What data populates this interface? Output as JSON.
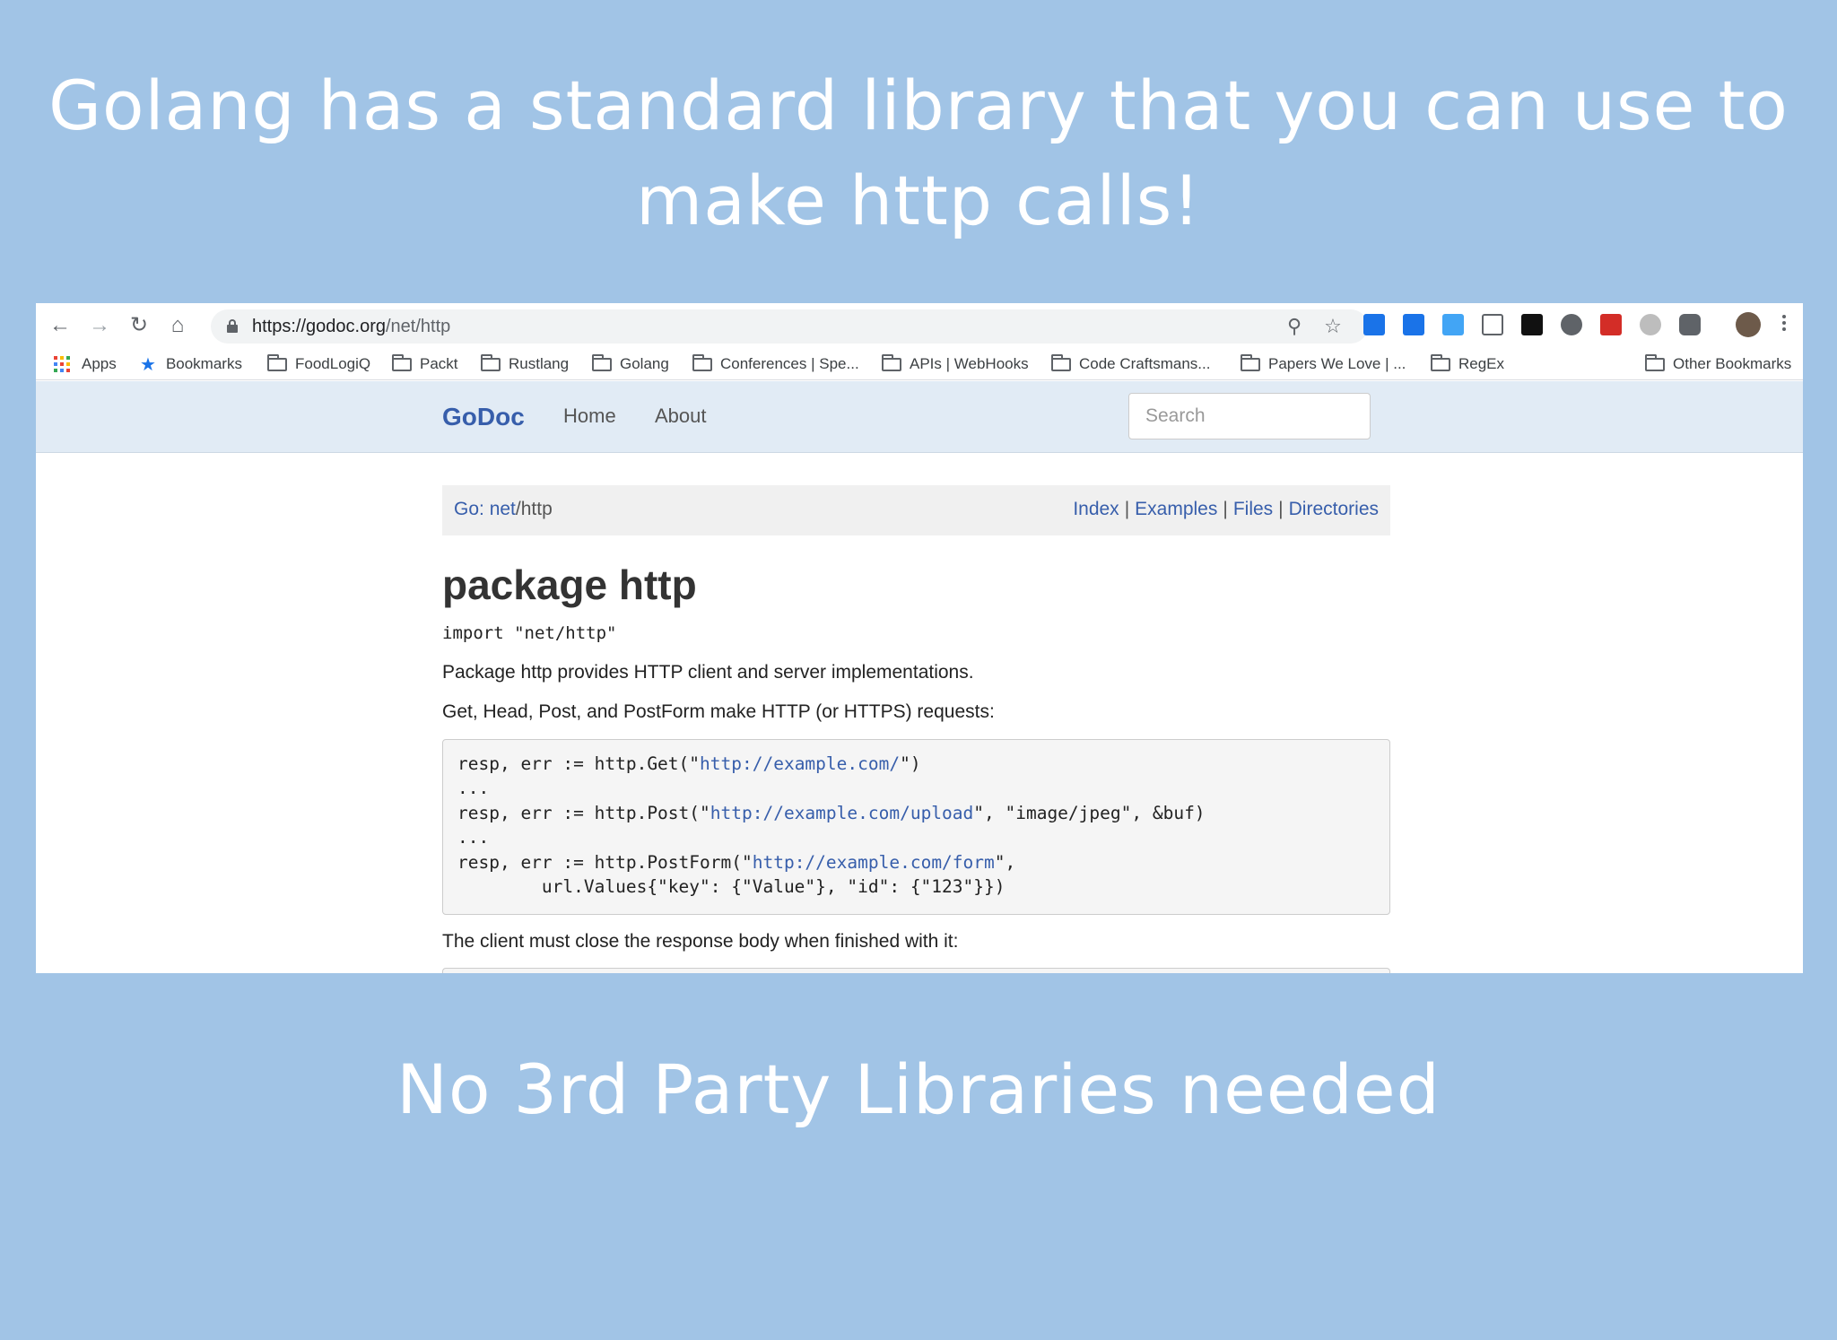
{
  "slide": {
    "headline_line1": "Golang has a standard library that you can use to",
    "headline_line2": "make http calls!",
    "subline": "No 3rd Party Libraries needed",
    "background_color": "#a1c4e6"
  },
  "browser": {
    "address": {
      "host": "https://godoc.org",
      "path": "/net/http"
    },
    "toolbar_icons": [
      "back-arrow-icon",
      "forward-arrow-icon",
      "reload-icon",
      "home-icon",
      "lock-icon",
      "zoom-icon",
      "bookmark-star-icon",
      "kebab-menu-icon"
    ],
    "extensions": [
      {
        "name": "extension-expand-icon",
        "color": "#1a73e8"
      },
      {
        "name": "extension-edit-icon",
        "color": "#1a73e8"
      },
      {
        "name": "extension-window-icon",
        "color": "#42a5f5"
      },
      {
        "name": "extension-screenshot-icon",
        "color": "#5f6368"
      },
      {
        "name": "extension-perplexity-icon",
        "color": "#111111"
      },
      {
        "name": "extension-gear-icon",
        "color": "#5f6368"
      },
      {
        "name": "extension-lastpass-icon",
        "color": "#d32d27"
      },
      {
        "name": "extension-cloud-icon",
        "color": "#bdbdbd"
      },
      {
        "name": "extension-pocket-icon",
        "color": "#5f6368"
      },
      {
        "name": "profile-avatar",
        "color": "#6d5a4a"
      }
    ],
    "bookmarks": {
      "apps": "Apps",
      "bookmarks": "Bookmarks",
      "folders": [
        "FoodLogiQ",
        "Packt",
        "Rustlang",
        "Golang",
        "Conferences | Spe...",
        "APIs | WebHooks",
        "Code Craftsmans...",
        "Papers We Love | ...",
        "RegEx"
      ],
      "other": "Other Bookmarks"
    }
  },
  "godoc": {
    "brand": "GoDoc",
    "nav_home": "Home",
    "nav_about": "About",
    "search_placeholder": "Search",
    "breadcrumb_prefix": "Go: ",
    "breadcrumb_net": "net",
    "breadcrumb_http": "/http",
    "links": {
      "index": "Index",
      "examples": "Examples",
      "files": "Files",
      "directories": "Directories",
      "separator": "|"
    },
    "title": "package http",
    "import": "import \"net/http\"",
    "para1": "Package http provides HTTP client and server implementations.",
    "para2": "Get, Head, Post, and PostForm make HTTP (or HTTPS) requests:",
    "code": {
      "l1_pre": "resp, err := http.Get(\"",
      "l1_link": "http://example.com/",
      "l1_post": "\")",
      "l2": "...",
      "l3_pre": "resp, err := http.Post(\"",
      "l3_link": "http://example.com/upload",
      "l3_post": "\", \"image/jpeg\", &buf)",
      "l4": "...",
      "l5_pre": "resp, err := http.PostForm(\"",
      "l5_link": "http://example.com/form",
      "l5_post": "\",",
      "l6": "\turl.Values{\"key\": {\"Value\"}, \"id\": {\"123\"}})"
    },
    "para3": "The client must close the response body when finished with it:"
  }
}
